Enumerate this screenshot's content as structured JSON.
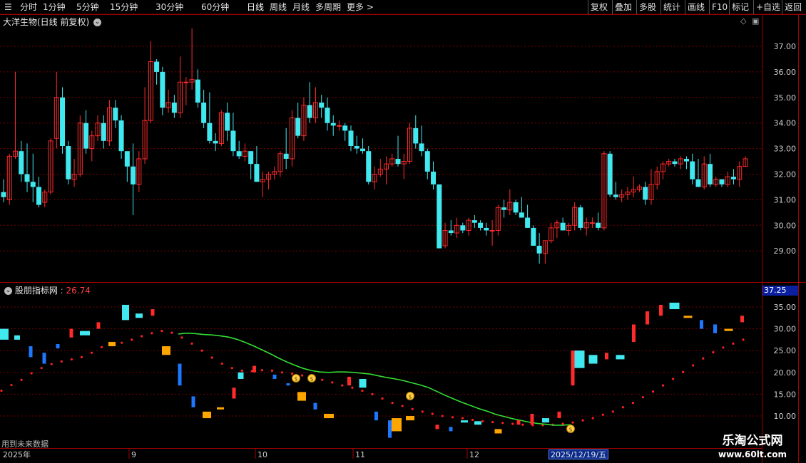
{
  "toolbar": {
    "left": [
      "分时",
      "1分钟",
      "5分钟",
      "15分钟",
      "30分钟",
      "60分钟",
      "日线",
      "周线",
      "月线",
      "多周期",
      "更多 >"
    ],
    "active": "日线",
    "right": [
      "复权",
      "叠加",
      "多股",
      "统计",
      "画线",
      "F10",
      "标记",
      "+自选",
      "返回"
    ]
  },
  "main_panel": {
    "title": "大洋生物(日线 前复权)"
  },
  "indicator_panel": {
    "name": "股朋指标网",
    "value": "26.74",
    "right_box": "37.25",
    "future_note": "用到未来数据"
  },
  "date_axis": {
    "year": "2025年",
    "months": [
      "9",
      "10",
      "11",
      "12"
    ],
    "cursor_date": "2025/12/19/五"
  },
  "watermark": {
    "name": "乐淘公式网",
    "url": "www.60lt.com"
  },
  "colors": {
    "up": "#ff2a2a",
    "down": "#40e8f0",
    "ma": "#33dd33",
    "dots": "#ff2020",
    "orange": "#ffa500",
    "blue": "#1e78ff",
    "grid": "#7a0000"
  },
  "chart_data": [
    {
      "type": "candlestick",
      "title": "大洋生物(日线 前复权)",
      "y_ticks": [
        37.0,
        36.0,
        35.0,
        34.0,
        33.0,
        32.0,
        31.0,
        30.0,
        29.0
      ],
      "ylim": [
        28.3,
        38.0
      ],
      "ohlc": [
        [
          31.3,
          31.8,
          30.9,
          31.1
        ],
        [
          31.0,
          32.8,
          30.8,
          32.7
        ],
        [
          32.7,
          36.0,
          32.6,
          32.9
        ],
        [
          32.9,
          33.3,
          31.7,
          32.0
        ],
        [
          32.0,
          33.2,
          31.3,
          31.7
        ],
        [
          31.7,
          32.8,
          30.9,
          31.5
        ],
        [
          31.5,
          31.9,
          30.7,
          30.8
        ],
        [
          30.9,
          31.4,
          30.7,
          31.3
        ],
        [
          31.3,
          33.4,
          31.2,
          33.3
        ],
        [
          33.4,
          36.0,
          33.0,
          35.0
        ],
        [
          35.0,
          35.4,
          32.8,
          33.1
        ],
        [
          33.1,
          33.3,
          31.6,
          31.8
        ],
        [
          31.8,
          32.6,
          31.5,
          32.0
        ],
        [
          32.0,
          34.3,
          31.9,
          34.0
        ],
        [
          34.0,
          34.5,
          32.8,
          33.0
        ],
        [
          33.0,
          33.7,
          32.5,
          33.5
        ],
        [
          33.5,
          34.3,
          33.3,
          34.0
        ],
        [
          34.0,
          34.3,
          33.0,
          33.3
        ],
        [
          33.3,
          34.9,
          33.1,
          34.6
        ],
        [
          34.6,
          34.9,
          33.8,
          34.1
        ],
        [
          34.1,
          34.3,
          32.6,
          32.9
        ],
        [
          32.9,
          32.8,
          31.7,
          32.3
        ],
        [
          32.3,
          33.2,
          30.4,
          31.6
        ],
        [
          31.6,
          32.9,
          31.3,
          32.6
        ],
        [
          32.6,
          35.4,
          32.4,
          34.1
        ],
        [
          34.1,
          37.2,
          34.0,
          36.4
        ],
        [
          36.4,
          36.5,
          35.5,
          36.0
        ],
        [
          36.0,
          36.2,
          34.3,
          34.6
        ],
        [
          34.6,
          35.3,
          34.4,
          34.8
        ],
        [
          34.8,
          35.1,
          34.2,
          34.4
        ],
        [
          34.4,
          36.6,
          34.2,
          35.6
        ],
        [
          35.6,
          35.8,
          34.7,
          35.6
        ],
        [
          35.6,
          37.7,
          35.3,
          35.7
        ],
        [
          35.7,
          36.1,
          34.6,
          34.8
        ],
        [
          34.8,
          35.3,
          33.8,
          34.0
        ],
        [
          34.0,
          35.2,
          33.2,
          33.3
        ],
        [
          33.3,
          33.6,
          32.9,
          33.2
        ],
        [
          33.2,
          34.5,
          33.1,
          34.4
        ],
        [
          34.4,
          34.8,
          33.3,
          33.7
        ],
        [
          33.7,
          34.4,
          32.7,
          32.9
        ],
        [
          32.9,
          33.3,
          32.6,
          32.7
        ],
        [
          32.7,
          33.2,
          32.5,
          32.9
        ],
        [
          32.9,
          32.9,
          31.8,
          32.4
        ],
        [
          32.4,
          33.1,
          31.7,
          31.7
        ],
        [
          31.7,
          32.1,
          31.1,
          31.8
        ],
        [
          31.8,
          32.1,
          31.4,
          32.0
        ],
        [
          32.0,
          32.3,
          31.8,
          32.1
        ],
        [
          32.1,
          32.9,
          31.9,
          32.8
        ],
        [
          32.8,
          33.8,
          32.2,
          32.6
        ],
        [
          32.6,
          34.5,
          32.3,
          34.2
        ],
        [
          34.2,
          34.8,
          33.4,
          33.5
        ],
        [
          33.5,
          35.0,
          33.3,
          34.7
        ],
        [
          34.7,
          35.6,
          34.0,
          34.2
        ],
        [
          34.2,
          35.4,
          34.0,
          34.8
        ],
        [
          34.8,
          35.1,
          34.2,
          34.6
        ],
        [
          34.6,
          35.0,
          33.7,
          34.0
        ],
        [
          34.0,
          34.3,
          33.5,
          33.9
        ],
        [
          33.9,
          34.1,
          33.7,
          33.9
        ],
        [
          33.9,
          34.0,
          33.3,
          33.7
        ],
        [
          33.7,
          33.9,
          32.9,
          33.1
        ],
        [
          33.1,
          33.5,
          32.8,
          33.0
        ],
        [
          33.0,
          33.4,
          32.8,
          32.9
        ],
        [
          32.9,
          33.1,
          31.6,
          31.7
        ],
        [
          31.7,
          32.3,
          31.4,
          32.0
        ],
        [
          32.0,
          32.6,
          31.9,
          32.2
        ],
        [
          32.2,
          32.7,
          31.6,
          32.4
        ],
        [
          32.4,
          32.8,
          32.3,
          32.6
        ],
        [
          32.6,
          33.5,
          32.3,
          32.4
        ],
        [
          32.4,
          32.8,
          31.8,
          32.5
        ],
        [
          32.5,
          34.0,
          32.4,
          33.8
        ],
        [
          33.8,
          34.3,
          33.0,
          33.2
        ],
        [
          33.2,
          33.9,
          32.7,
          32.9
        ],
        [
          32.9,
          33.0,
          31.8,
          32.1
        ],
        [
          32.1,
          32.5,
          31.4,
          31.6
        ],
        [
          31.6,
          31.6,
          29.2,
          29.1
        ],
        [
          29.2,
          30.1,
          29.1,
          29.8
        ],
        [
          29.8,
          30.2,
          29.6,
          29.7
        ],
        [
          29.7,
          30.3,
          29.5,
          30.0
        ],
        [
          30.0,
          30.1,
          29.7,
          29.8
        ],
        [
          29.8,
          30.3,
          29.6,
          30.2
        ],
        [
          30.2,
          30.4,
          29.9,
          30.1
        ],
        [
          30.1,
          30.2,
          29.8,
          29.9
        ],
        [
          29.9,
          30.1,
          29.6,
          29.8
        ],
        [
          29.8,
          30.2,
          29.2,
          29.8
        ],
        [
          29.8,
          30.8,
          29.6,
          30.7
        ],
        [
          30.7,
          31.0,
          30.3,
          30.6
        ],
        [
          30.6,
          31.4,
          30.4,
          30.9
        ],
        [
          30.9,
          31.0,
          30.4,
          30.5
        ],
        [
          30.5,
          31.1,
          30.3,
          30.3
        ],
        [
          30.3,
          30.8,
          29.9,
          29.9
        ],
        [
          29.9,
          30.0,
          29.2,
          29.2
        ],
        [
          29.2,
          29.7,
          28.5,
          28.9
        ],
        [
          28.9,
          29.4,
          28.5,
          29.4
        ],
        [
          29.4,
          30.1,
          29.3,
          29.9
        ],
        [
          29.9,
          30.2,
          29.5,
          30.1
        ],
        [
          30.1,
          30.3,
          29.8,
          29.8
        ],
        [
          29.8,
          30.1,
          29.6,
          30.0
        ],
        [
          30.0,
          30.9,
          29.8,
          30.7
        ],
        [
          30.7,
          30.8,
          29.8,
          29.9
        ],
        [
          29.9,
          30.3,
          29.6,
          30.1
        ],
        [
          30.1,
          30.3,
          29.9,
          30.1
        ],
        [
          30.1,
          30.5,
          29.8,
          29.9
        ],
        [
          29.9,
          32.9,
          29.8,
          32.8
        ],
        [
          32.8,
          32.9,
          31.1,
          31.2
        ],
        [
          31.2,
          31.7,
          31.0,
          31.1
        ],
        [
          31.1,
          31.4,
          30.9,
          31.2
        ],
        [
          31.2,
          31.5,
          31.0,
          31.3
        ],
        [
          31.3,
          31.9,
          31.1,
          31.4
        ],
        [
          31.4,
          31.6,
          31.3,
          31.5
        ],
        [
          31.5,
          31.7,
          30.8,
          31.0
        ],
        [
          31.0,
          32.2,
          30.8,
          31.6
        ],
        [
          31.6,
          32.3,
          31.4,
          32.1
        ],
        [
          32.1,
          32.5,
          31.8,
          32.4
        ],
        [
          32.4,
          32.6,
          32.3,
          32.5
        ],
        [
          32.5,
          32.6,
          32.3,
          32.4
        ],
        [
          32.4,
          32.7,
          32.2,
          32.6
        ],
        [
          32.6,
          32.7,
          32.2,
          32.5
        ],
        [
          32.5,
          32.8,
          31.6,
          31.8
        ],
        [
          31.8,
          32.6,
          31.5,
          31.5
        ],
        [
          31.5,
          32.7,
          31.4,
          32.4
        ],
        [
          32.4,
          32.8,
          31.5,
          31.6
        ],
        [
          31.6,
          31.9,
          31.5,
          31.8
        ],
        [
          31.8,
          31.8,
          31.5,
          31.6
        ],
        [
          31.6,
          32.1,
          31.5,
          31.9
        ],
        [
          31.9,
          32.2,
          31.6,
          31.8
        ],
        [
          31.8,
          32.5,
          31.5,
          32.3
        ],
        [
          32.3,
          32.7,
          32.3,
          32.6
        ]
      ]
    },
    {
      "type": "line",
      "title": "股朋指标网",
      "y_ticks": [
        35.0,
        30.0,
        25.0,
        20.0,
        15.0,
        10.0
      ],
      "ylim": [
        6.5,
        37.5
      ],
      "series": [
        {
          "values": [
            15.8,
            17.1,
            18.3,
            19.8,
            21.0,
            21.9,
            22.5,
            23.0,
            23.5,
            24.5,
            25.8,
            26.4,
            26.8,
            27.5,
            28.3,
            29.0,
            29.5,
            29.1,
            28.0,
            26.6,
            25.0,
            23.4,
            22.0,
            21.0,
            20.4,
            20.3,
            20.5,
            20.4,
            20.0,
            19.7,
            19.3,
            18.8,
            18.3,
            17.7,
            17.0,
            16.5,
            15.8,
            15.0,
            14.0,
            13.0,
            12.3,
            11.6,
            11.0,
            10.5,
            10.0,
            9.7,
            9.5,
            9.1,
            8.8,
            8.6,
            8.4,
            8.2,
            8.0,
            7.9,
            7.9,
            8.0,
            8.2,
            8.5,
            9.0,
            9.5,
            10.3,
            11.0,
            12.0,
            13.0,
            14.3,
            15.6,
            17.0,
            18.5,
            20.1,
            21.6,
            23.2,
            24.6,
            25.7,
            26.6,
            27.5
          ]
        },
        {
          "values": [
            28.8,
            29.0,
            28.9,
            28.7,
            28.6,
            28.4,
            28.1,
            27.6,
            26.9,
            26.1,
            25.2,
            24.3,
            23.3,
            22.4,
            21.6,
            20.9,
            20.4,
            20.1,
            20.0,
            20.1,
            20.1,
            20.0,
            19.8,
            19.6,
            19.2,
            18.8,
            18.5,
            18.1,
            17.6,
            17.1,
            16.5,
            15.6,
            14.7,
            13.9,
            13.1,
            12.4,
            11.7,
            11.1,
            10.4,
            9.9,
            9.4,
            9.0,
            8.6,
            8.3,
            8.1,
            7.9,
            7.9,
            8.0
          ]
        }
      ]
    }
  ]
}
